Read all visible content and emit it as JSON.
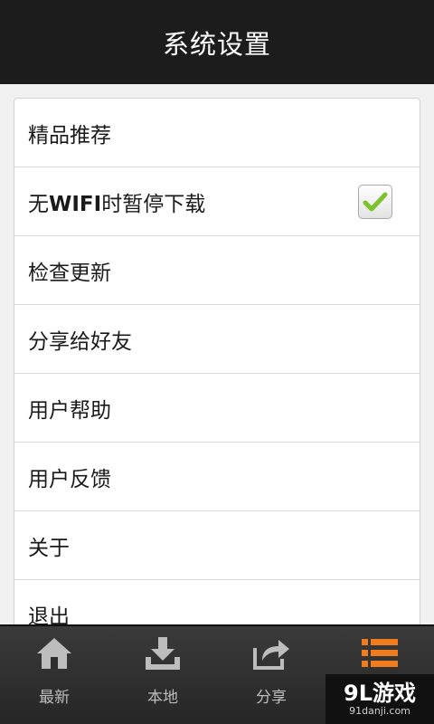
{
  "header": {
    "title": "系统设置"
  },
  "settings": {
    "items": [
      {
        "label": "精品推荐"
      },
      {
        "label_prefix": "无",
        "label_bold": "WIFI",
        "label_suffix": "时暂停下载",
        "checked": true
      },
      {
        "label": "检查更新"
      },
      {
        "label": "分享给好友"
      },
      {
        "label": "用户帮助"
      },
      {
        "label": "用户反馈"
      },
      {
        "label": "关于"
      },
      {
        "label": "退出"
      }
    ]
  },
  "bottom_nav": {
    "items": [
      {
        "label": "最新",
        "icon": "home-icon"
      },
      {
        "label": "本地",
        "icon": "download-icon"
      },
      {
        "label": "分享",
        "icon": "share-icon"
      },
      {
        "label": "",
        "icon": "list-menu-icon",
        "active": true
      }
    ],
    "active_color": "#f07c1e"
  },
  "watermark": {
    "main": "9L游戏",
    "sub": "91danji.com"
  }
}
